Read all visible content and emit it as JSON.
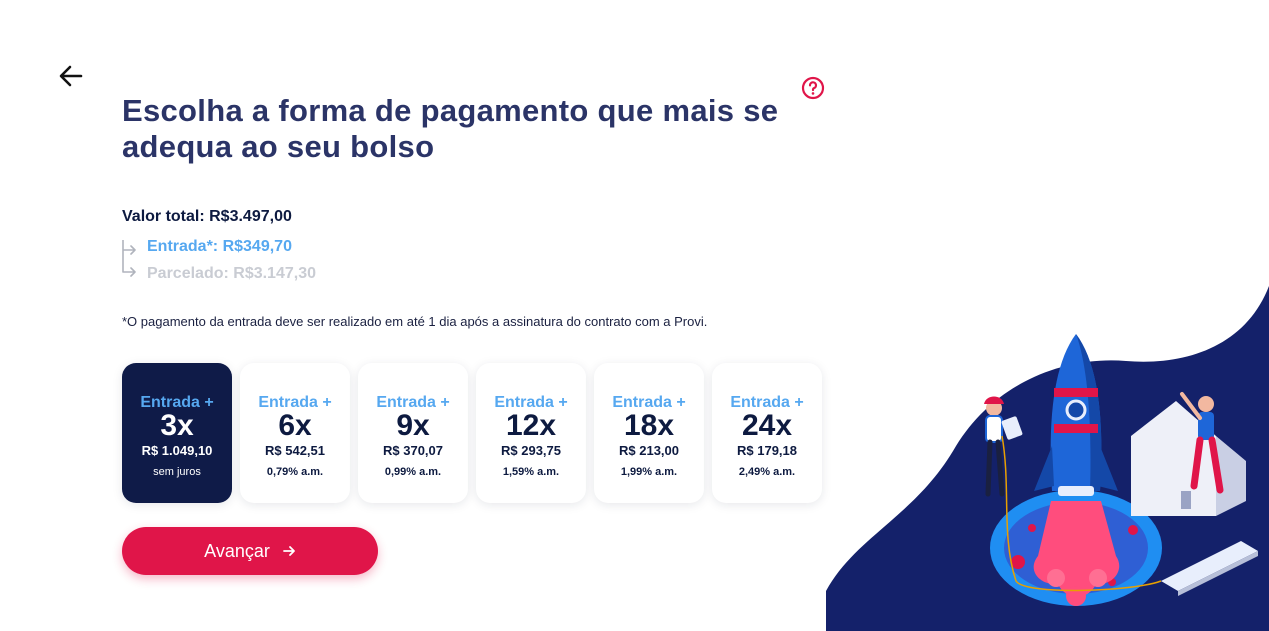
{
  "icons": {
    "back": "arrow-left-icon",
    "help": "question-circle-icon",
    "advance": "arrow-right-icon"
  },
  "colors": {
    "title": "#2b3467",
    "accent_blue": "#56a8f0",
    "selected_card": "#0f1b48",
    "button": "#e01549",
    "muted": "#c9ccd3"
  },
  "header": {
    "title": "Escolha a forma de pagamento que mais se adequa ao seu bolso"
  },
  "summary": {
    "total": "Valor total: R$3.497,00",
    "entrada": "Entrada*: R$349,70",
    "parcelado": "Parcelado: R$3.147,30"
  },
  "note": "*O pagamento da entrada deve ser realizado em até 1 dia após a assinatura do contrato com a Provi.",
  "options": [
    {
      "entrada": "Entrada +",
      "count": "3x",
      "value": "R$ 1.049,10",
      "rate": "sem juros",
      "selected": true
    },
    {
      "entrada": "Entrada +",
      "count": "6x",
      "value": "R$ 542,51",
      "rate": "0,79% a.m.",
      "selected": false
    },
    {
      "entrada": "Entrada +",
      "count": "9x",
      "value": "R$ 370,07",
      "rate": "0,99% a.m.",
      "selected": false
    },
    {
      "entrada": "Entrada +",
      "count": "12x",
      "value": "R$ 293,75",
      "rate": "1,59% a.m.",
      "selected": false
    },
    {
      "entrada": "Entrada +",
      "count": "18x",
      "value": "R$ 213,00",
      "rate": "1,99% a.m.",
      "selected": false
    },
    {
      "entrada": "Entrada +",
      "count": "24x",
      "value": "R$ 179,18",
      "rate": "2,49% a.m.",
      "selected": false
    }
  ],
  "actions": {
    "advance": "Avançar"
  }
}
